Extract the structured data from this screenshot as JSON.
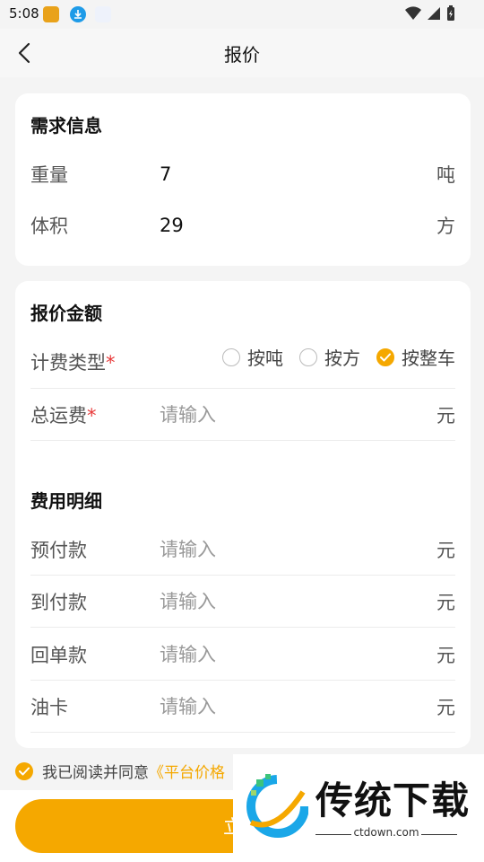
{
  "status_bar": {
    "time": "5:08"
  },
  "nav": {
    "title": "报价"
  },
  "demand": {
    "title": "需求信息",
    "rows": [
      {
        "label": "重量",
        "value": "7",
        "unit": "吨"
      },
      {
        "label": "体积",
        "value": "29",
        "unit": "方"
      }
    ]
  },
  "quote": {
    "title": "报价金额",
    "billing_type": {
      "label": "计费类型",
      "required_mark": "*",
      "options": [
        "按吨",
        "按方",
        "按整车"
      ],
      "selected": "按整车"
    },
    "total_fee": {
      "label": "总运费",
      "required_mark": "*",
      "placeholder": "请输入",
      "unit": "元"
    }
  },
  "details": {
    "title": "费用明细",
    "rows": [
      {
        "label": "预付款",
        "placeholder": "请输入",
        "unit": "元"
      },
      {
        "label": "到付款",
        "placeholder": "请输入",
        "unit": "元"
      },
      {
        "label": "回单款",
        "placeholder": "请输入",
        "unit": "元"
      },
      {
        "label": "油卡",
        "placeholder": "请输入",
        "unit": "元"
      }
    ]
  },
  "agreement": {
    "text": "我已阅读并同意",
    "link": "《平台价格"
  },
  "submit": {
    "label": "立即"
  },
  "watermark": {
    "text": "传统下载",
    "sub": "ctdown.com"
  },
  "colors": {
    "accent": "#f5a800",
    "required": "#e83a3a"
  }
}
